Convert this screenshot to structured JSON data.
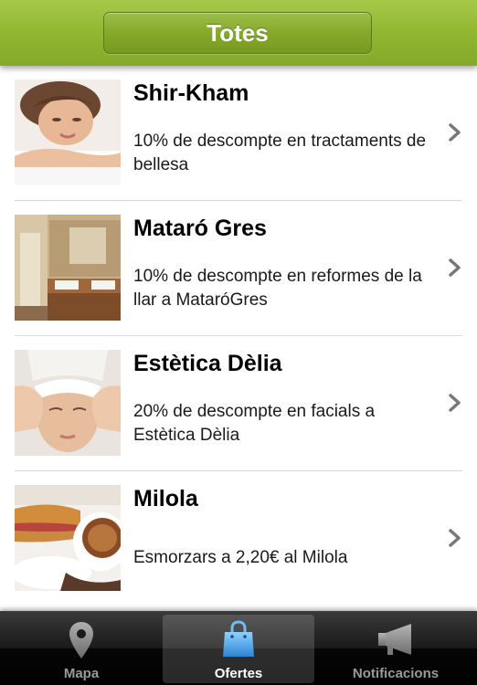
{
  "header": {
    "filter_label": "Totes"
  },
  "offers": [
    {
      "title": "Shir-Kham",
      "description": "10% de descompte en tractaments de bellesa",
      "image": "woman-spa-photo"
    },
    {
      "title": "Mataró Gres",
      "description": "10% de descompte en reformes de la llar a MataróGres",
      "image": "bathroom-photo"
    },
    {
      "title": "Estètica Dèlia",
      "description": "20% de descompte en facials a Estètica Dèlia",
      "image": "facial-massage-photo"
    },
    {
      "title": "Milola",
      "description": "Esmorzars a 2,20€ al Milola",
      "image": "breakfast-photo"
    }
  ],
  "tabbar": {
    "tabs": [
      {
        "label": "Mapa",
        "icon": "map-pin-icon",
        "selected": false
      },
      {
        "label": "Ofertes",
        "icon": "shopping-bag-icon",
        "selected": true
      },
      {
        "label": "Notificacions",
        "icon": "megaphone-icon",
        "selected": false
      }
    ]
  },
  "colors": {
    "header_green": "#93b832",
    "tab_selected_blue": "#3a9be8"
  }
}
